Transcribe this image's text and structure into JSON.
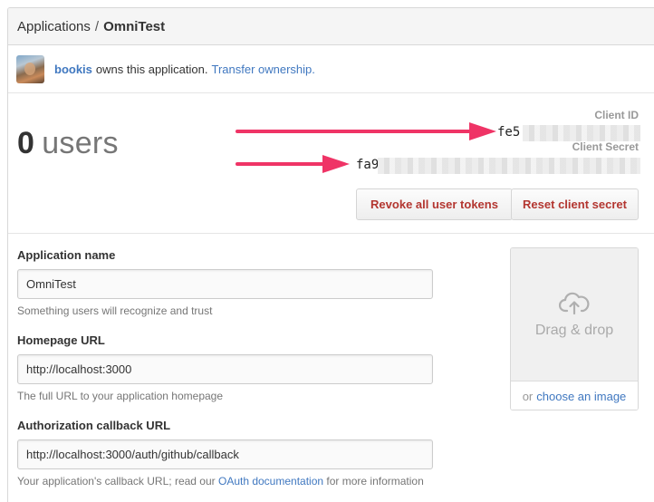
{
  "breadcrumb": {
    "parent": "Applications",
    "separator": "/",
    "current": "OmniTest"
  },
  "owner": {
    "username": "bookis",
    "text": "owns this application.",
    "transfer_link": "Transfer ownership."
  },
  "stats": {
    "count": "0",
    "unit": "users"
  },
  "credentials": {
    "client_id_label": "Client ID",
    "client_id_visible": "fe5",
    "client_secret_label": "Client Secret",
    "client_secret_visible": "fa9"
  },
  "buttons": {
    "revoke": "Revoke all user tokens",
    "reset": "Reset client secret"
  },
  "form": {
    "app_name": {
      "label": "Application name",
      "value": "OmniTest",
      "note": "Something users will recognize and trust"
    },
    "homepage": {
      "label": "Homepage URL",
      "value": "http://localhost:3000",
      "note": "The full URL to your application homepage"
    },
    "callback": {
      "label": "Authorization callback URL",
      "value": "http://localhost:3000/auth/github/callback",
      "note_prefix": "Your application's callback URL; read our",
      "note_link": "OAuth documentation",
      "note_suffix": "for more information"
    }
  },
  "dropzone": {
    "label": "Drag & drop",
    "or_text": "or",
    "choose_link": "choose an image"
  },
  "colors": {
    "link": "#4078c0",
    "danger": "#b33630",
    "arrow": "#ef3466"
  },
  "icons": {
    "upload": "cloud-upload-icon",
    "arrow": "arrow-right-icon"
  }
}
